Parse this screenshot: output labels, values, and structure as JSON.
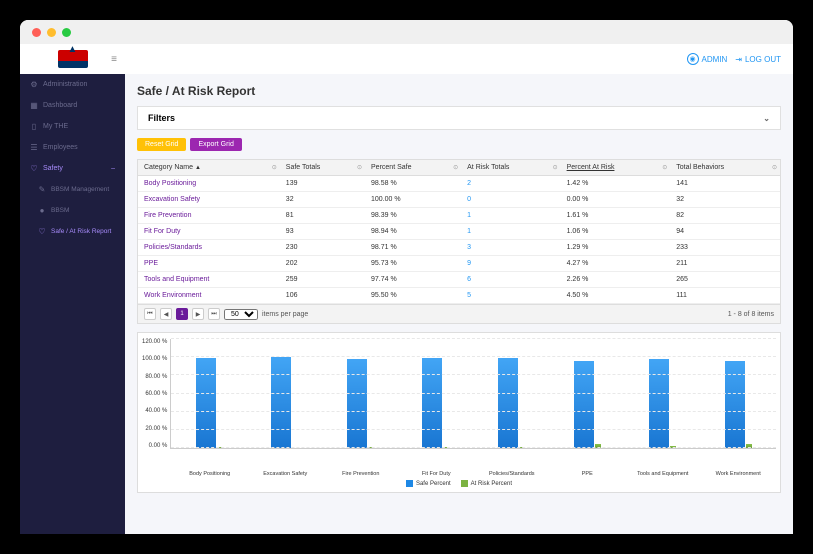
{
  "header": {
    "user": "ADMIN",
    "logout": "LOG OUT"
  },
  "sidebar": {
    "items": [
      {
        "icon": "⚙",
        "label": "Administration"
      },
      {
        "icon": "▦",
        "label": "Dashboard"
      },
      {
        "icon": "▯",
        "label": "My THE"
      },
      {
        "icon": "☰",
        "label": "Employees"
      },
      {
        "icon": "♡",
        "label": "Safety",
        "expand": "–"
      }
    ],
    "subitems": [
      {
        "icon": "✎",
        "label": "BBSM Management"
      },
      {
        "icon": "●",
        "label": "BBSM"
      },
      {
        "icon": "♡",
        "label": "Safe / At Risk Report"
      }
    ]
  },
  "page": {
    "title": "Safe / At Risk Report",
    "filters_label": "Filters"
  },
  "buttons": {
    "reset": "Reset Grid",
    "export": "Export Grid"
  },
  "grid": {
    "columns": [
      "Category Name",
      "Safe Totals",
      "Percent Safe",
      "At Risk Totals",
      "Percent At Risk",
      "Total Behaviors"
    ],
    "sorted_col": 4,
    "rows": [
      [
        "Body Positioning",
        "139",
        "98.58 %",
        "2",
        "1.42 %",
        "141"
      ],
      [
        "Excavation Safety",
        "32",
        "100.00 %",
        "0",
        "0.00 %",
        "32"
      ],
      [
        "Fire Prevention",
        "81",
        "98.39 %",
        "1",
        "1.61 %",
        "82"
      ],
      [
        "Fit For Duty",
        "93",
        "98.94 %",
        "1",
        "1.06 %",
        "94"
      ],
      [
        "Policies/Standards",
        "230",
        "98.71 %",
        "3",
        "1.29 %",
        "233"
      ],
      [
        "PPE",
        "202",
        "95.73 %",
        "9",
        "4.27 %",
        "211"
      ],
      [
        "Tools and Equipment",
        "259",
        "97.74 %",
        "6",
        "2.26 %",
        "265"
      ],
      [
        "Work Environment",
        "106",
        "95.50 %",
        "5",
        "4.50 %",
        "111"
      ]
    ]
  },
  "pager": {
    "page_size_options": [
      "50"
    ],
    "per_page_label": "items per page",
    "current": "1",
    "summary": "1 - 8 of 8 items"
  },
  "chart_data": {
    "type": "bar",
    "categories": [
      "Body Positioning",
      "Excavation Safety",
      "Fire Prevention",
      "Fit For Duty",
      "Policies/Standards",
      "PPE",
      "Tools and Equipment",
      "Work Environment"
    ],
    "series": [
      {
        "name": "Safe Percent",
        "values": [
          98.58,
          100.0,
          98.39,
          98.94,
          98.71,
          95.73,
          97.74,
          95.5
        ]
      },
      {
        "name": "At Risk Percent",
        "values": [
          1.42,
          0.0,
          1.61,
          1.06,
          1.29,
          4.27,
          2.26,
          4.5
        ]
      }
    ],
    "ylabel": "",
    "ylim": [
      0,
      120
    ],
    "yticks": [
      0,
      20,
      40,
      60,
      80,
      100,
      120
    ],
    "ytick_labels": [
      "0.00 %",
      "20.00 %",
      "40.00 %",
      "60.00 %",
      "80.00 %",
      "100.00 %",
      "120.00 %"
    ],
    "legend": [
      "Safe Percent",
      "At Risk Percent"
    ]
  }
}
